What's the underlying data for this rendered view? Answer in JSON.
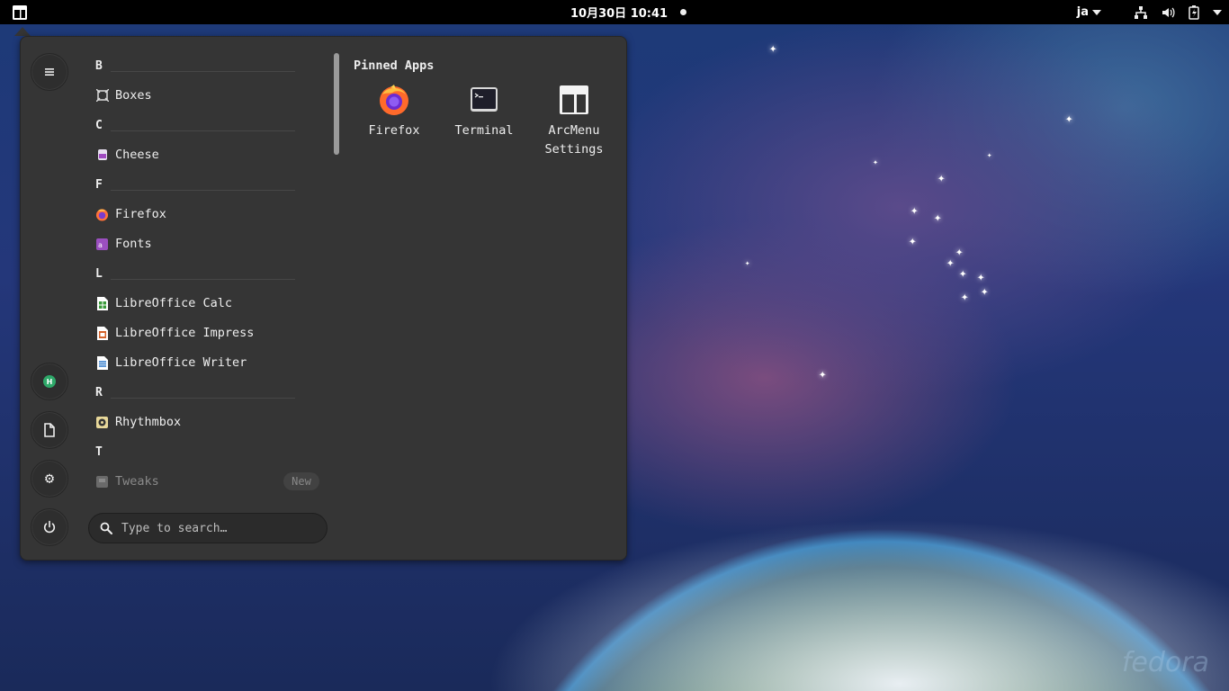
{
  "topbar": {
    "clock": "10月30日 10:41",
    "language": "ja"
  },
  "menu": {
    "pinned_title": "Pinned Apps",
    "search_placeholder": "Type to search…",
    "groups": [
      {
        "letter": "B",
        "apps": [
          "Boxes"
        ]
      },
      {
        "letter": "C",
        "apps": [
          "Cheese"
        ]
      },
      {
        "letter": "F",
        "apps": [
          "Firefox",
          "Fonts"
        ]
      },
      {
        "letter": "L",
        "apps": [
          "LibreOffice Calc",
          "LibreOffice Impress",
          "LibreOffice Writer"
        ]
      },
      {
        "letter": "R",
        "apps": [
          "Rhythmbox"
        ]
      },
      {
        "letter": "T",
        "apps": [
          "Tweaks"
        ]
      }
    ],
    "new_badge": "New",
    "pinned": [
      {
        "label": "Firefox",
        "icon": "firefox-icon"
      },
      {
        "label": "Terminal",
        "icon": "terminal-icon"
      },
      {
        "label_line1": "ArcMenu",
        "label_line2": "Settings",
        "icon": "arcmenu-settings-icon"
      }
    ],
    "sidebar": {
      "avatar_letter": "H"
    }
  },
  "desktop": {
    "watermark": "fedora"
  },
  "colors": {
    "menu_bg": "#353535",
    "topbar_bg": "#000000",
    "avatar": "#2ea869"
  }
}
